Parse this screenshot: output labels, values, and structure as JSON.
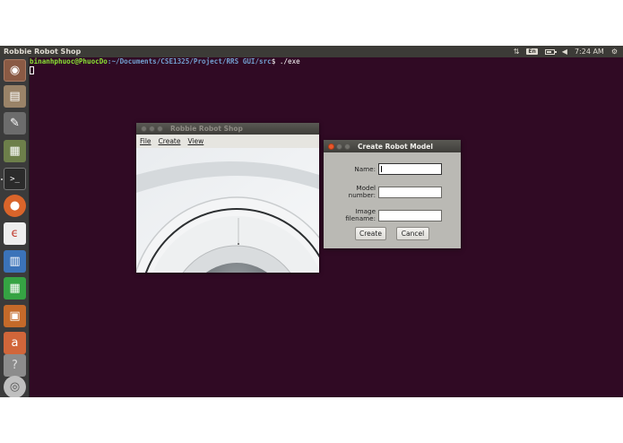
{
  "top_panel": {
    "app_title": "Robbie Robot Shop",
    "keyboard_layout": "En",
    "time": "7:24 AM",
    "battery_level": 0.7
  },
  "terminal": {
    "user_host": "binanhphuoc@PhuocDo",
    "path": ":~/Documents/CSE1325/Project/RRS GUI/src",
    "command": "$ ./exe"
  },
  "main_window": {
    "title": "Robbie Robot Shop",
    "menu": [
      "File",
      "Create",
      "View"
    ]
  },
  "dialog": {
    "title": "Create Robot Model",
    "fields": [
      {
        "label": "Name:",
        "value": ""
      },
      {
        "label": "Model\nnumber:",
        "value": ""
      },
      {
        "label": "Image\nfilename:",
        "value": ""
      }
    ],
    "create_label": "Create",
    "cancel_label": "Cancel"
  },
  "launcher_items": [
    {
      "icon": "ubuntu-logo-icon",
      "glyph": "◉"
    },
    {
      "icon": "files-icon",
      "glyph": "▤"
    },
    {
      "icon": "text-editor-icon",
      "glyph": "✎"
    },
    {
      "icon": "system-monitor-icon",
      "glyph": "▦"
    },
    {
      "icon": "terminal-icon",
      "glyph": ">_"
    },
    {
      "icon": "firefox-icon",
      "glyph": "●"
    },
    {
      "icon": "pdf-viewer-icon",
      "glyph": "ϵ"
    },
    {
      "icon": "writer-icon",
      "glyph": "▥"
    },
    {
      "icon": "calc-icon",
      "glyph": "▦"
    },
    {
      "icon": "impress-icon",
      "glyph": "▣"
    },
    {
      "icon": "software-center-icon",
      "glyph": "a"
    },
    {
      "icon": "help-icon",
      "glyph": "?"
    },
    {
      "icon": "disk-icon",
      "glyph": "◎"
    }
  ]
}
